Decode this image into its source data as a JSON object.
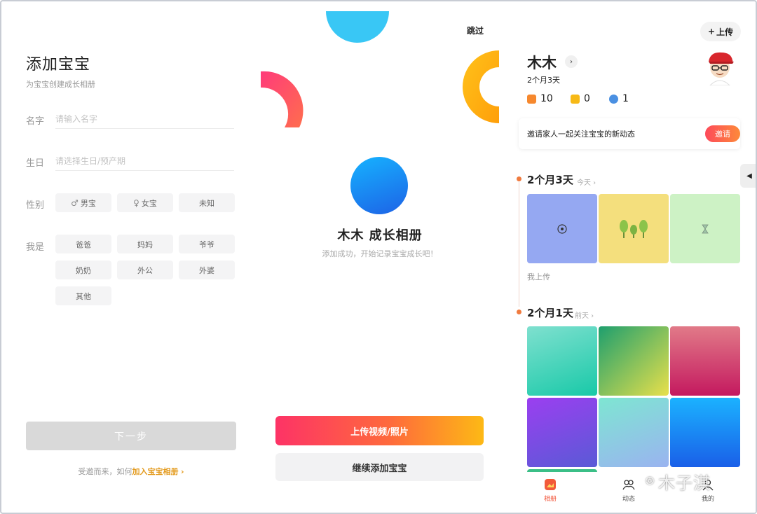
{
  "panel_add": {
    "title": "添加宝宝",
    "subtitle": "为宝宝创建成长相册",
    "name_label": "名字",
    "name_placeholder": "请输入名字",
    "birthday_label": "生日",
    "birthday_placeholder": "请选择生日/预产期",
    "gender_label": "性别",
    "genders": [
      {
        "symbol": "♂",
        "label": "男宝"
      },
      {
        "symbol": "♀",
        "label": "女宝"
      },
      {
        "symbol": "",
        "label": "未知"
      }
    ],
    "role_label": "我是",
    "roles": [
      "爸爸",
      "妈妈",
      "爷爷",
      "奶奶",
      "外公",
      "外婆",
      "其他"
    ],
    "next_button": "下一步",
    "invite_text": "受邀而来，如何",
    "invite_link": "加入宝宝相册",
    "invite_arrow": "›"
  },
  "panel_success": {
    "skip": "跳过",
    "album_title": "木木 成长相册",
    "album_sub": "添加成功，开始记录宝宝成长吧！",
    "upload_button": "上传视频/照片",
    "continue_button": "继续添加宝宝"
  },
  "panel_album": {
    "upload_pill": "上传",
    "upload_plus": "+",
    "baby_name": "木木",
    "name_arrow": "›",
    "age": "2个月3天",
    "stats": {
      "photos": "10",
      "videos": "0",
      "members": "1"
    },
    "invite_card_text": "邀请家人一起关注宝宝的新动态",
    "invite_card_button": "邀请",
    "handle_arrow": "◀",
    "section1": {
      "title": "2个月3天",
      "when": "今天 ›",
      "uploader": "我上传"
    },
    "section2": {
      "title": "2个月1天",
      "when": "前天 ›"
    },
    "nav": [
      {
        "label": "相册",
        "active": true
      },
      {
        "label": "动态",
        "active": false
      },
      {
        "label": "我的",
        "active": false
      }
    ]
  },
  "watermark": "木子淇",
  "colors": {
    "accent_orange": "#e39a1c",
    "gradient_start": "#fd3366",
    "gradient_end": "#fdb915",
    "blue_circle": "#1d62e6"
  }
}
